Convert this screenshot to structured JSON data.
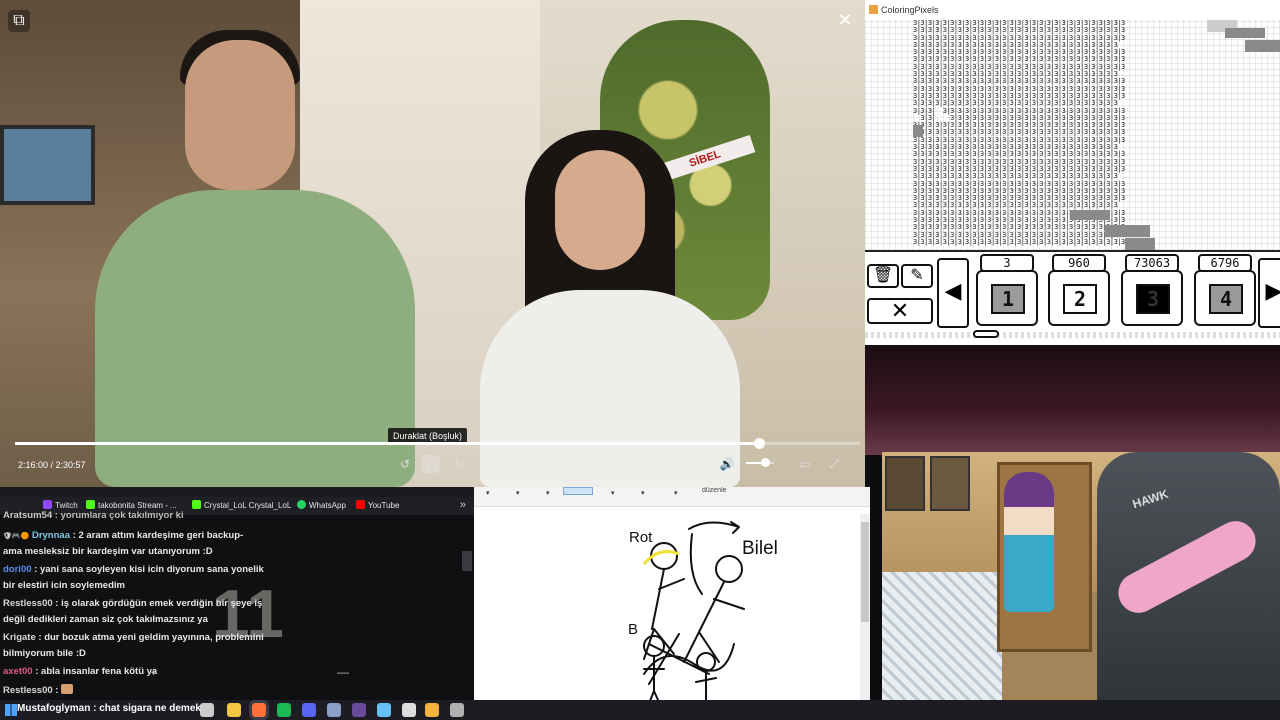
{
  "video": {
    "tooltip": "Duraklat (Boşluk)",
    "time": "2:16:00 / 2:30:57",
    "progress_fraction": 0.88,
    "volume_fraction": 0.6,
    "expand_glyph": "⧉",
    "close_glyph": "✕",
    "controls": {
      "rewind": "↺",
      "pause": "❚❚",
      "forward": "↻",
      "volume": "🔊",
      "captions": "▭",
      "fullscreen": "⤢"
    },
    "wreath_text": "SİBEL"
  },
  "coloring_pixels": {
    "title": "ColoringPixels",
    "grid_rows": [
      "3|3|3|3|3|3|3|3|3|3|3|3|3|3|3|3|3|3|3|3|3|3|3|3|3|3|3|3|3",
      "3|3|3|3|3|3|3|3|3|3|3|3|3|3|3|3|3|3|3|3|3|3|3|3|3|3|3|3|3",
      "3|3|3|3|3|3|3|3|3|3|3|3|3|3|3|3|3|3|3|3|3|3|3|3|3|3|3|3|3",
      "3|3|3|3|3|3|3|3|3|3|3|3|3|3|3|3|3|3|3|3|3|3|3|3|3|3|3|3",
      "3|3|3|3|3|3|3|3|3|3|3|3|3|3|3|3|3|3|3|3|3|3|3|3|3|3|3|3|3",
      "3|3|3|3|3|3|3|3|3|3|3|3|3|3|3|3|3|3|3|3|3|3|3|3|3|3|3|3|3",
      "3|3|3|3|3|3|3|3|3|3|3|3|3|3|3|3|3|3|3|3|3|3|3|3|3|3|3|3|3",
      "3|3|3|3|3|3|3|3|3|3|3|3|3|3|3|3|3|3|3|3|3|3|3|3|3|3|3|3",
      "3|3|3|3|3|3|3|3|3|3|3|3|3|3|3|3|3|3|3|3|3|3|3|3|3|3|3|3|3",
      "3|3|3|3|3|3|3|3|3|3|3|3|3|3|3|3|3|3|3|3|3|3|3|3|3|3|3|3|3",
      "3|3|3|3|3|3|3|3|3|3|3|3|3|3|3|3|3|3|3|3|3|3|3|3|3|3|3|3|3",
      "3|3|3|3|3|3|3|3|3|3|3|3|3|3|3|3|3|3|3|3|3|3|3|3|3|3|3|3",
      "3|3|3|  3|3|3|3|3|3|3|3|3|3|3|3|3|3|3|3|3|3|3|3|3|3|3|3|3",
      "  3|3|    3|3|3|3|3|3|3|3|3|3|3|3|3|3|3|3|3|3|3|3|3|3|3|3",
      "3|3|3|3|3|3|3|3|3|3|3|3|3|3|3|3|3|3|3|3|3|3|3|3|3|3|3|3|3",
      "3|3|3|3|3|3|3|3|3|3|3|3|3|3|3|3|3|3|3|3|3|3|3|3|3|3|3|3|3",
      "3|3|3|3|3|3|3|3|3|3|3|3|3|3|3|3|3|3|3|3|3|3|3|3|3|3|3|3|3",
      "3|3|3|3|3|3|3|3|3|3|3|3|3|3|3|3|3|3|3|3|3|3|3|3|3|3|3|3",
      "3|3|3|3|3|3|3|3|3|3|3|3|3|3|3|3|3|3|3|3|3|3|3|3|3|3|3|3|3",
      "3|3|3|3|3|3|3|3|3|3|3|3|3|3|3|3|3|3|3|3|3|3|3|3|3|3|3|3|3",
      "3|3|3|3|3|3|3|3|3|3|3|3|3|3|3|3|3|3|3|3|3|3|3|3|3|3|3|3|3",
      "3|3|3|3|3|3|3|3|3|3|3|3|3|3|3|3|3|3|3|3|3|3|3|3|3|3|3|3",
      "3|3|3|3|3|3|3|3|3|3|3|3|3|3|3|3|3|3|3|3|3|3|3|3|3|3|3|3|3",
      "3|3|3|3|3|3|3|3|3|3|3|3|3|3|3|3|3|3|3|3|3|3|3|3|3|3|3|3|3",
      "3|3|3|3|3|3|3|3|3|3|3|3|3|3|3|3|3|3|3|3|3|3|3|3|3|3|3|3|3",
      "3|3|3|3|3|3|3|3|3|3|3|3|3|3|3|3|3|3|3|3|3|3|3|3|3|3|3|3",
      "3|3|3|3|3|3|3|3|3|3|3|3|3|3|3|3|3|3|3|3|3|3|3|3|3|3|3|3|3",
      "3|3|3|3|3|3|3|3|3|3|3|3|3|3|3|3|3|3|3|3|3|3|3|3|3|3|3|3|3",
      "3|3|3|3|3|3|3|3|3|3|3|3|3|3|3|3|3|3|3|3|3|3|3|3|3|3|3|3|3",
      "3|3|3|3|3|3|3|3|3|3|3|3|3|3|3|3|3|3|3|3|3|3|3|3|3|3|3|3",
      "3|3|3|3|3|3|3|3|3|3|3|3|3|3|3|3|3|3|3|3|3|3|3|3|3|3|3|3|3"
    ],
    "tools": {
      "trash_glyph": "🗑",
      "eraser_glyph": "✎",
      "close_glyph": "✕"
    },
    "arrows": {
      "left": "◀",
      "right": "▶"
    },
    "colors": [
      {
        "count": "3",
        "number": "1",
        "bg": "#9a9a9a",
        "fg": "#111111"
      },
      {
        "count": "960",
        "number": "2",
        "bg": "#ffffff",
        "fg": "#111111"
      },
      {
        "count": "73063",
        "number": "3",
        "bg": "#000000",
        "fg": "#333333"
      },
      {
        "count": "6796",
        "number": "4",
        "bg": "#9a9a9a",
        "fg": "#111111"
      }
    ]
  },
  "webcam": {
    "chair_brand": "HAWK"
  },
  "browser": {
    "bookmarks": [
      {
        "label": "Twitch",
        "color": "#9146ff"
      },
      {
        "label": "takobonita Stream - ...",
        "color": "#53fc18"
      },
      {
        "label": "Crystal_LoL  Crystal_LoL",
        "color": "#53fc18"
      },
      {
        "label": "WhatsApp",
        "color": "#25d366"
      },
      {
        "label": "YouTube",
        "color": "#ff0000"
      }
    ],
    "more_glyph": "»",
    "chat_overlay_number": "11",
    "plus_glyph": "+",
    "minus_glyph": "—",
    "chat": [
      {
        "user": "Aratsum54",
        "sep": " : ",
        "text": "yorumlara çok takılmıyor ki",
        "user_color": "#c9c9c9"
      },
      {
        "user": "Drynnaa",
        "sep": " : ",
        "text": "2 aram attım kardeşime geri backup-",
        "user_color": "#7ec8e3",
        "badges": "🛡🎮🟠"
      },
      {
        "user": "",
        "sep": "",
        "text": "ama mesleksiz bir kardeşim var utanıyorum :D",
        "user_color": "#e8e8e8"
      },
      {
        "user": "dori00",
        "sep": " : ",
        "text": "yani sana soyleyen kisi icin diyorum sana yonelik",
        "user_color": "#5b8def"
      },
      {
        "user": "",
        "sep": "",
        "text": "bir elestiri icin soylemedim",
        "user_color": "#e8e8e8"
      },
      {
        "user": "Restless00",
        "sep": " : ",
        "text": "iş olarak gördüğün emek verdiğin bir şeye iş",
        "user_color": "#d7d7d7"
      },
      {
        "user": "",
        "sep": "",
        "text": "değil dedikleri zaman siz çok takılmazsınız ya",
        "user_color": "#e8e8e8"
      },
      {
        "user": "Krigate",
        "sep": " : ",
        "text": "dur bozuk atma yeni geldim yayınına, problemini",
        "user_color": "#d7d7d7"
      },
      {
        "user": "",
        "sep": "",
        "text": "bilmiyorum bile :D",
        "user_color": "#e8e8e8"
      },
      {
        "user": "axet00",
        "sep": " : ",
        "text": "abla insanlar fena kötü ya",
        "user_color": "#e05a8a"
      },
      {
        "user": "Restless00",
        "sep": " : ",
        "text": "",
        "user_color": "#d7d7d7",
        "emote": true
      }
    ]
  },
  "paint": {
    "edit_label": "düzenle",
    "drawing_labels": {
      "top_left": "Rot",
      "top_right": "Bilel",
      "bottom_left": "B"
    }
  },
  "taskbar": {
    "chat_overlay": "Mustafoglyman : chat sigara ne demek",
    "icons": [
      {
        "name": "windows-start-icon",
        "color": "#4aa3ff"
      },
      {
        "name": "search-icon",
        "color": "#cccccc"
      },
      {
        "name": "task-view-icon",
        "color": "#cccccc"
      },
      {
        "name": "file-explorer-icon",
        "color": "#f4c542"
      },
      {
        "name": "firefox-icon",
        "color": "#ff7139"
      },
      {
        "name": "spotify-icon",
        "color": "#1db954"
      },
      {
        "name": "discord-icon",
        "color": "#5865f2"
      },
      {
        "name": "app-icon",
        "color": "#8aa0c8"
      },
      {
        "name": "obs-icon",
        "color": "#6a4a9a"
      },
      {
        "name": "steam-icon",
        "color": "#66c0f4"
      },
      {
        "name": "github-icon",
        "color": "#dddddd"
      },
      {
        "name": "notes-icon",
        "color": "#f2b33d"
      },
      {
        "name": "app2-icon",
        "color": "#b0b0b0"
      }
    ]
  }
}
